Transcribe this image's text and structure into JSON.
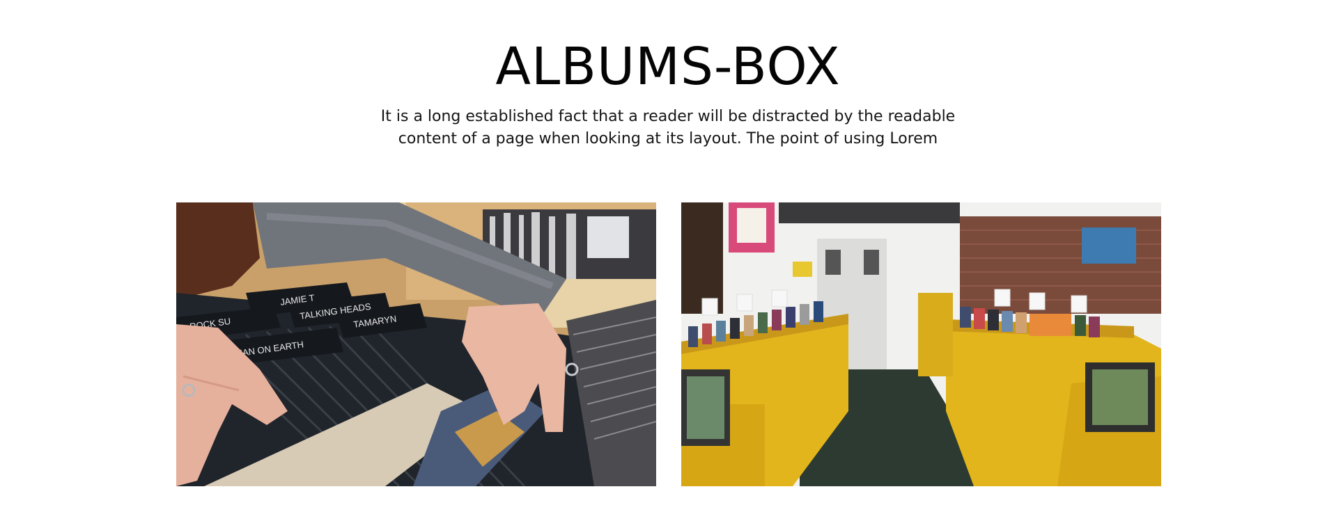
{
  "section": {
    "title": "ALBUMS-BOX",
    "description": "It is a long established fact that a reader will be distracted by the readable content of a page when looking at its layout. The point of using Lorem"
  },
  "gallery": {
    "photo_left": {
      "divider_labels": [
        "JAMIE T",
        "ROCK SU",
        "TALKING HEADS",
        "TAMARYN",
        "MAN ON EARTH"
      ]
    },
    "photo_right": {}
  },
  "colors": {
    "background": "#ffffff",
    "text": "#111111",
    "shelf_yellow": "#e3b51c",
    "sweater_gray": "#6f737a",
    "carpet_green": "#2c3a31"
  }
}
